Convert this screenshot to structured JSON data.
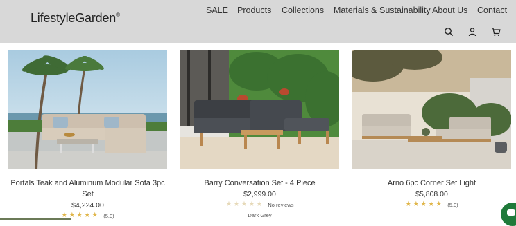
{
  "brand": {
    "name": "LifestyleGarden",
    "mark": "®"
  },
  "nav": {
    "items": [
      "SALE",
      "Products",
      "Collections",
      "Materials & Sustainability",
      "About Us",
      "Contact"
    ]
  },
  "icons": [
    "search-icon",
    "account-icon",
    "cart-icon"
  ],
  "products": [
    {
      "title_line1": "Portals Teak and Aluminum Modular Sofa 3pc",
      "title_line2": "Set",
      "price": "$4,224.00",
      "rating_text": "(5.0)",
      "stars": 5
    },
    {
      "title_line1": "Barry Conversation Set - 4 Piece",
      "title_line2": "",
      "price": "$2,999.00",
      "rating_text": "No reviews",
      "stars": 0,
      "variant": "Dark Grey"
    },
    {
      "title_line1": "Arno 6pc Corner Set Light",
      "title_line2": "",
      "price": "$5,808.00",
      "rating_text": "(5.0)",
      "stars": 5
    }
  ],
  "colors": {
    "header_bg": "#d8d8d8",
    "star": "#e0b64a",
    "chat": "#1f7a3a"
  }
}
